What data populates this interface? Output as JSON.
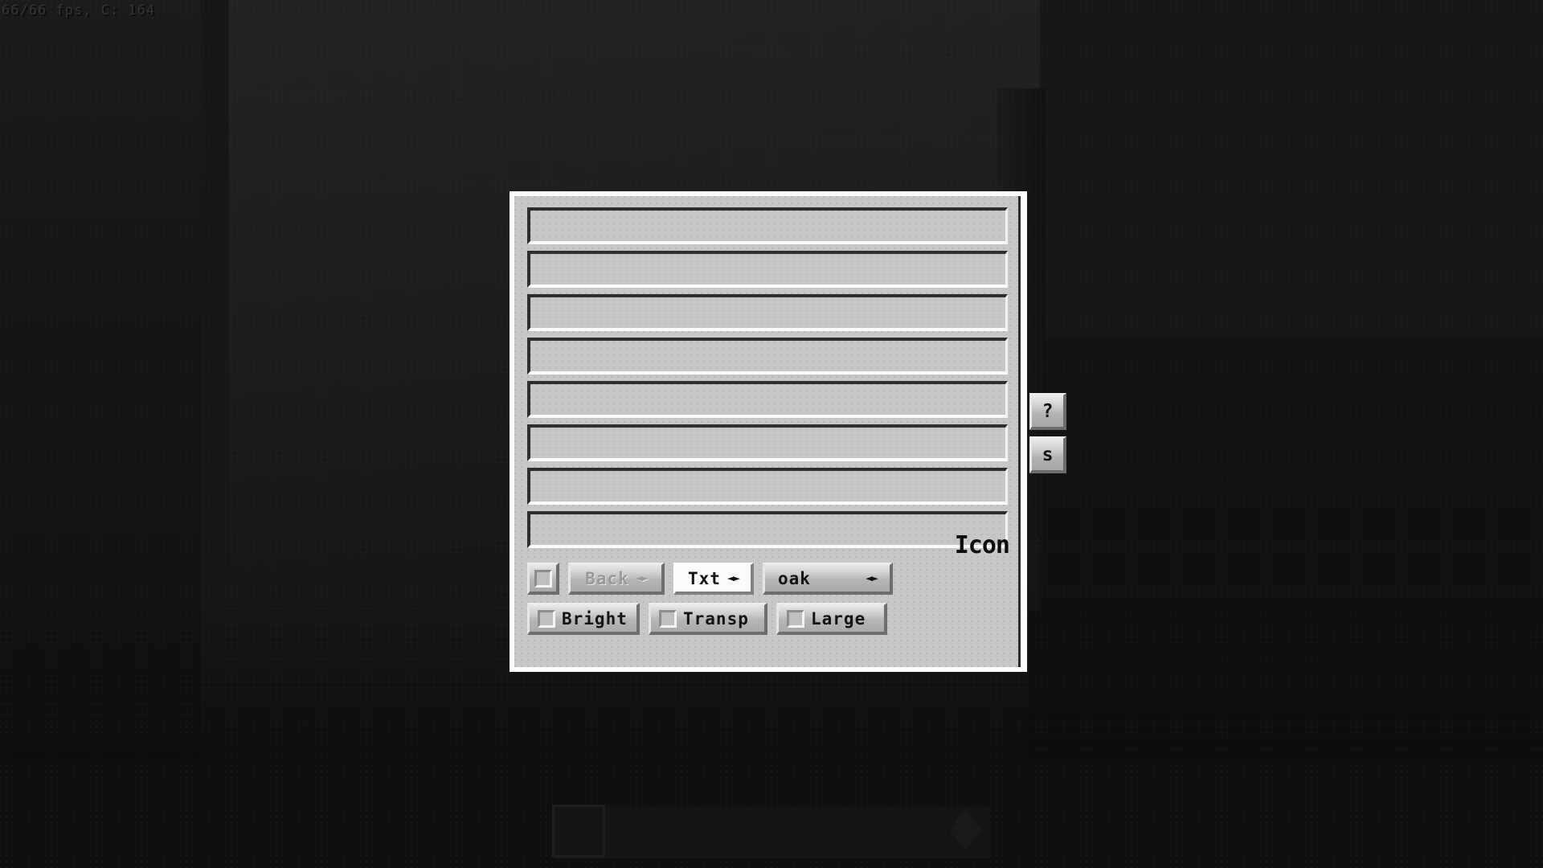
{
  "overlay": {
    "fps_text": "66/66 fps, C: 164"
  },
  "dialog": {
    "fields": [
      {
        "value": ""
      },
      {
        "value": ""
      },
      {
        "value": ""
      },
      {
        "value": ""
      },
      {
        "value": ""
      },
      {
        "value": ""
      },
      {
        "value": ""
      },
      {
        "value": ""
      }
    ],
    "controls": {
      "page_checkbox": {
        "label": "",
        "checked": false
      },
      "back_button": {
        "label": "Back",
        "arrows": "◄►",
        "disabled": true
      },
      "txt_button": {
        "label": "Txt",
        "arrows": "◄►",
        "active": true
      },
      "wood_selector": {
        "label": "oak",
        "arrows": "◄►"
      },
      "bright_toggle": {
        "label": "Bright",
        "checked": false
      },
      "transp_toggle": {
        "label": "Transp",
        "checked": false
      },
      "large_toggle": {
        "label": "Large",
        "checked": false
      }
    },
    "icon_label": "Icon"
  },
  "side_tabs": [
    {
      "label": "?",
      "name": "help"
    },
    {
      "label": "s",
      "name": "settings"
    }
  ],
  "colors": {
    "panel": "#c8c8c8",
    "panel_border": "#fdfdfd",
    "button_face": "#bdbdbd",
    "text": "#141414",
    "disabled_text": "#9a9a9a",
    "active_field": "#fbfbfb",
    "background": "#161616"
  },
  "hotbar": {
    "slot_count": 9,
    "selected_index": 0,
    "item_slot_index": 8
  }
}
